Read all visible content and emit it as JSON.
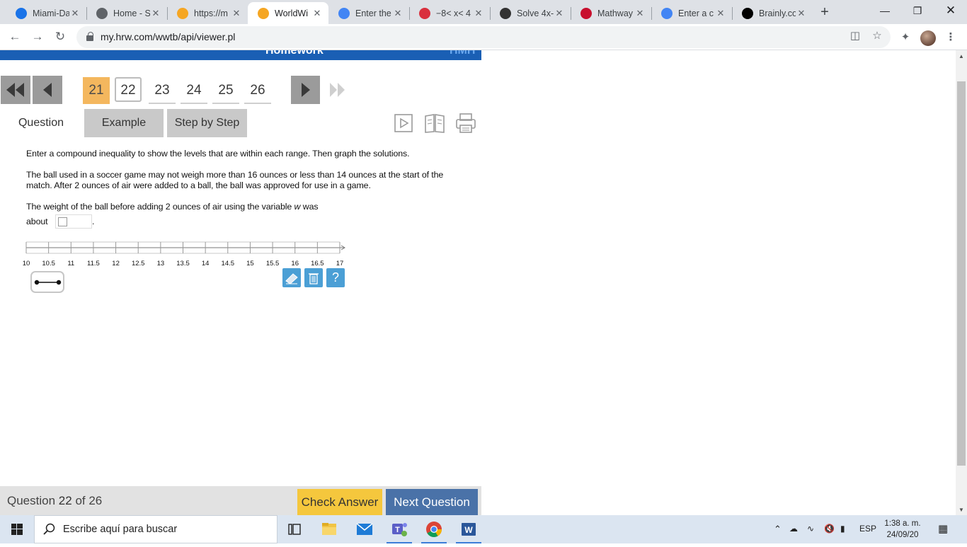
{
  "browser": {
    "tabs": [
      {
        "title": "Miami-Da",
        "favicon": "miami-dade-icon",
        "color": "#1a73e8"
      },
      {
        "title": "Home - S",
        "favicon": "globe-icon",
        "color": "#5f6368"
      },
      {
        "title": "https://m",
        "favicon": "orange-dot-icon",
        "color": "#f5a623"
      },
      {
        "title": "WorldWi",
        "favicon": "orange-dot-icon",
        "color": "#f5a623"
      },
      {
        "title": "Enter the",
        "favicon": "google-icon",
        "color": "#4285f4"
      },
      {
        "title": "−8< x< 4",
        "favicon": "symbolab-icon",
        "color": "#d9303e"
      },
      {
        "title": "Solve 4x-",
        "favicon": "panda-icon",
        "color": "#333333"
      },
      {
        "title": "Mathway",
        "favicon": "mathway-icon",
        "color": "#c8102e"
      },
      {
        "title": "Enter a c",
        "favicon": "google-icon",
        "color": "#4285f4"
      },
      {
        "title": "Brainly.co",
        "favicon": "brainly-icon",
        "color": "#000000"
      }
    ],
    "active_tab": 3,
    "url": "my.hrw.com/wwtb/api/viewer.pl"
  },
  "header": {
    "title": "Homework",
    "logo": "HMH"
  },
  "question_nav": {
    "numbers": [
      "21",
      "22",
      "23",
      "24",
      "25",
      "26"
    ],
    "current": "22",
    "visited": "21"
  },
  "tabs": {
    "question": "Question",
    "example": "Example",
    "step_by_step": "Step by Step"
  },
  "question": {
    "instruction": "Enter a compound inequality to show the levels that are within each range. Then graph the solutions.",
    "problem": "The ball used in a soccer game may not weigh more than 16 ounces or less than 14 ounces at the start of the match. After 2 ounces of air were added to a ball, the ball was approved for use in a game.",
    "prompt_line1_before": "The weight of the ball before adding 2 ounces of air using the variable ",
    "prompt_variable": "w",
    "prompt_line1_after": "  was",
    "prompt_line2": "about",
    "prompt_end": ".",
    "answer_value": ""
  },
  "number_line": {
    "labels": [
      "10",
      "10.5",
      "11",
      "11.5",
      "12",
      "12.5",
      "13",
      "13.5",
      "14",
      "14.5",
      "15",
      "15.5",
      "16",
      "16.5",
      "17"
    ],
    "min": 10,
    "max": 17,
    "step": 0.5
  },
  "footer": {
    "question_word": "Question",
    "question_number": "22",
    "of_text": "of 26",
    "check_answer": "Check Answer",
    "next_question": "Next Question",
    "check_color": "#f5c73d",
    "next_color": "#4a72a8"
  },
  "taskbar": {
    "search_placeholder": "Escribe aquí para buscar",
    "language": "ESP",
    "time": "1:38 a. m.",
    "date": "24/09/20"
  }
}
